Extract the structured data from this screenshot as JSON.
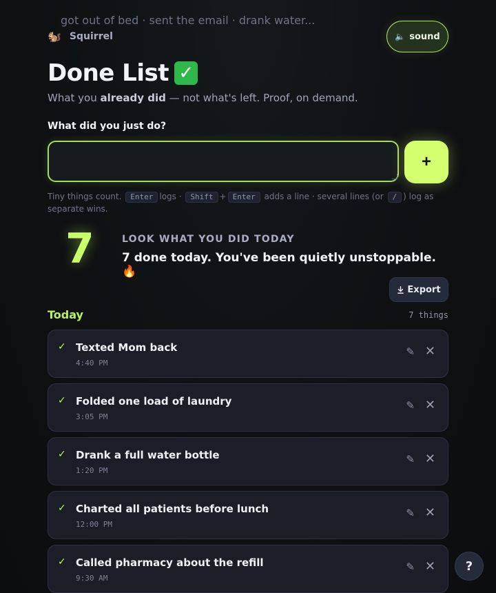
{
  "app": {
    "brand_name": "Squirrel",
    "brand_icon": "squirrel-icon"
  },
  "header": {
    "sound_label": "sound",
    "title": "Done List",
    "subtitle_pre": "What you ",
    "subtitle_bold": "already did",
    "subtitle_post": " — not what's left. Proof, on demand."
  },
  "entry": {
    "label": "What did you just do?",
    "placeholder": "got out of bed · sent the email · drank water...",
    "value": "",
    "add_label": "+"
  },
  "hint": {
    "t1": "Tiny things count.",
    "k1": "Enter",
    "t2": "logs ·",
    "k2": "Shift",
    "plus": "+",
    "k3": "Enter",
    "t3": "adds a line · several lines (or",
    "k4": "/",
    "t4": ") log as separate wins."
  },
  "stats": {
    "count": "7",
    "kicker": "LOOK WHAT YOU DID TODAY",
    "summary": "7 done today. You've been quietly unstoppable. 🔥"
  },
  "export_label": "Export",
  "section": {
    "title": "Today",
    "count_text": "7 things"
  },
  "items": [
    {
      "text": "Texted Mom back",
      "time": "4:40 PM"
    },
    {
      "text": "Folded one load of laundry",
      "time": "3:05 PM"
    },
    {
      "text": "Drank a full water bottle",
      "time": "1:20 PM"
    },
    {
      "text": "Charted all patients before lunch",
      "time": "12:00 PM"
    },
    {
      "text": "Called pharmacy about the refill",
      "time": "9:30 AM"
    }
  ],
  "help_label": "?",
  "colors": {
    "accent": "#c8ff6a",
    "accent_text": "#b9f35c",
    "background": "#0e1012",
    "card": "#1b1e27"
  }
}
